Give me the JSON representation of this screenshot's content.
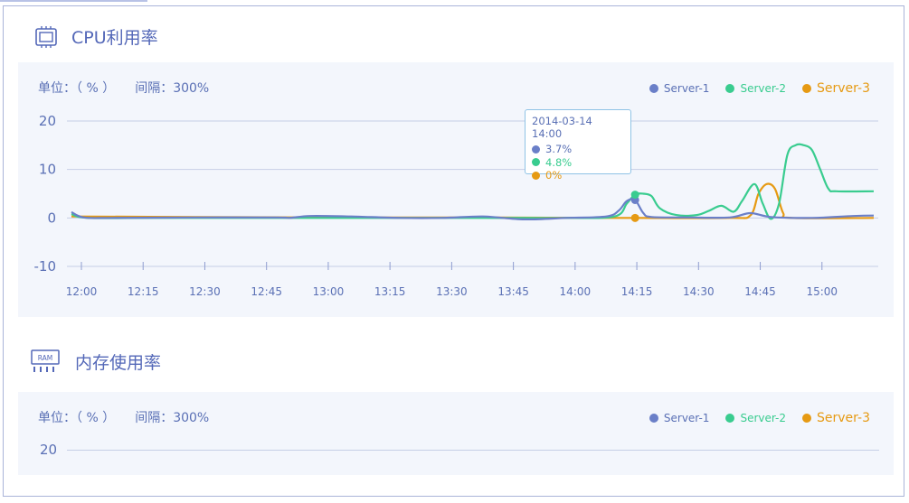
{
  "colors": {
    "server1": "#6a7fc8",
    "server2": "#39cc8f",
    "server3": "#e69a13",
    "accent": "#5468b8"
  },
  "cpu": {
    "title": "CPU利用率",
    "icon": "cpu-chip-icon",
    "unit_label": "单位：（ % ）",
    "interval_label": "间隔：300%",
    "legend": [
      "Server-1",
      "Server-2",
      "Server-3"
    ],
    "tooltip": {
      "date": "2014-03-14  14:00",
      "values": [
        "3.7%",
        "4.8%",
        "0%"
      ]
    }
  },
  "ram": {
    "title": "内存使用率",
    "icon": "ram-module-icon",
    "icon_text": "RAM",
    "unit_label": "单位：（ % ）",
    "interval_label": "间隔：300%",
    "legend": [
      "Server-1",
      "Server-2",
      "Server-3"
    ],
    "y_ticks": [
      "20"
    ]
  },
  "chart_data": [
    {
      "type": "line",
      "title": "CPU利用率",
      "ylabel": "单位：（ % ）",
      "ylim": [
        -10,
        20
      ],
      "y_ticks": [
        "20",
        "10",
        "0",
        "-10"
      ],
      "x_ticks": [
        "12:00",
        "12:15",
        "12:30",
        "12:45",
        "13:00",
        "13:15",
        "13:30",
        "13:45",
        "14:00",
        "14:15",
        "14:30",
        "14:45",
        "15:00"
      ],
      "x_range_minutes": [
        0,
        195
      ],
      "series": [
        {
          "name": "Server-1",
          "points": [
            [
              0,
              1.2
            ],
            [
              3,
              0.1
            ],
            [
              10,
              0
            ],
            [
              30,
              0.1
            ],
            [
              50,
              0.1
            ],
            [
              53,
              0
            ],
            [
              58,
              0.4
            ],
            [
              68,
              0.3
            ],
            [
              80,
              0
            ],
            [
              90,
              0
            ],
            [
              100,
              0.3
            ],
            [
              110,
              -0.3
            ],
            [
              120,
              0
            ],
            [
              130,
              0.3
            ],
            [
              133,
              1.5
            ],
            [
              135,
              3.5
            ],
            [
              137,
              3.7
            ],
            [
              139,
              1
            ],
            [
              141,
              0.2
            ],
            [
              150,
              0.1
            ],
            [
              160,
              0.1
            ],
            [
              165,
              1
            ],
            [
              170,
              0.2
            ],
            [
              180,
              0
            ],
            [
              190,
              0.4
            ],
            [
              195,
              0.5
            ]
          ]
        },
        {
          "name": "Server-2",
          "points": [
            [
              0,
              0.8
            ],
            [
              4,
              0
            ],
            [
              20,
              0
            ],
            [
              60,
              0
            ],
            [
              100,
              0
            ],
            [
              120,
              0
            ],
            [
              132,
              0.3
            ],
            [
              135,
              3
            ],
            [
              137,
              4.8
            ],
            [
              139,
              5
            ],
            [
              141,
              4.5
            ],
            [
              143,
              2
            ],
            [
              147,
              0.6
            ],
            [
              152,
              0.6
            ],
            [
              155,
              1.5
            ],
            [
              158,
              2.5
            ],
            [
              161,
              1.3
            ],
            [
              163,
              3.5
            ],
            [
              166,
              7
            ],
            [
              168,
              3
            ],
            [
              170,
              -0.2
            ],
            [
              172,
              3
            ],
            [
              174,
              13
            ],
            [
              176,
              15
            ],
            [
              178,
              15
            ],
            [
              180,
              14
            ],
            [
              182,
              10
            ],
            [
              184,
              6
            ],
            [
              186,
              5.5
            ],
            [
              195,
              5.5
            ]
          ]
        },
        {
          "name": "Server-3",
          "points": [
            [
              0,
              0.3
            ],
            [
              30,
              0.2
            ],
            [
              60,
              0.1
            ],
            [
              100,
              0.1
            ],
            [
              130,
              0
            ],
            [
              137,
              0
            ],
            [
              160,
              0
            ],
            [
              165,
              0.5
            ],
            [
              167,
              5
            ],
            [
              169,
              7
            ],
            [
              171,
              6
            ],
            [
              173,
              1
            ],
            [
              175,
              0
            ],
            [
              195,
              0
            ]
          ]
        }
      ],
      "tooltip_x_minutes": 137
    },
    {
      "type": "line",
      "title": "内存使用率",
      "ylabel": "单位：（ % ）",
      "y_ticks": [
        "20"
      ],
      "series": [
        {
          "name": "Server-1",
          "points": []
        },
        {
          "name": "Server-2",
          "points": []
        },
        {
          "name": "Server-3",
          "points": []
        }
      ]
    }
  ]
}
